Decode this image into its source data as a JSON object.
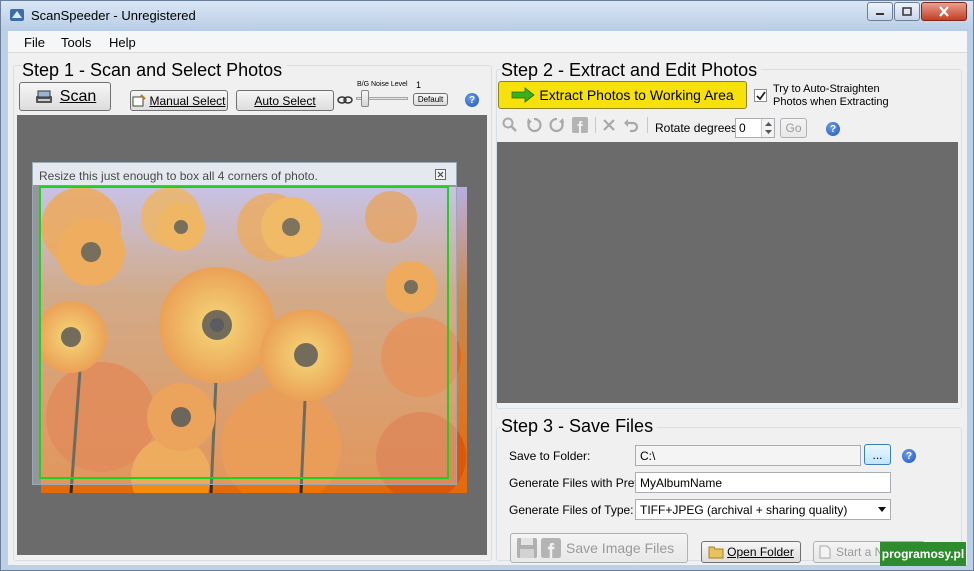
{
  "window": {
    "title": "ScanSpeeder - Unregistered"
  },
  "menu": [
    "File",
    "Tools",
    "Help"
  ],
  "step1": {
    "title": "Step 1 - Scan and Select Photos",
    "scan_label": "Scan",
    "manual_select_label": "Manual Select",
    "auto_select_label": "Auto Select",
    "noise_label": "B/G Noise Level",
    "noise_value": "1",
    "default_label": "Default",
    "selection_hint": "Resize this just enough to box all 4 corners of photo."
  },
  "step2": {
    "title": "Step 2 - Extract and Edit Photos",
    "extract_label": "Extract Photos to Working Area",
    "auto_straighten_label_line1": "Try to Auto-Straighten",
    "auto_straighten_label_line2": "Photos when Extracting",
    "auto_straighten_checked": true,
    "rotate_label": "Rotate degrees:",
    "rotate_value": "0",
    "go_label": "Go"
  },
  "step3": {
    "title": "Step 3 - Save Files",
    "folder_label": "Save to Folder:",
    "folder_value": "C:\\",
    "browse_label": "...",
    "prefix_label": "Generate Files with Prefix:",
    "prefix_value": "MyAlbumName",
    "type_label": "Generate Files of Type:",
    "type_value": "TIFF+JPEG (archival + sharing quality)",
    "save_label": "Save Image Files",
    "open_folder_label": "Open Folder",
    "start_new_label": "Start a Ne"
  },
  "watermark": "programosy.pl",
  "colors": {
    "extract_button": "#f7e10a",
    "selection_border": "#1fd11f",
    "work_area": "#6b6b6b"
  }
}
